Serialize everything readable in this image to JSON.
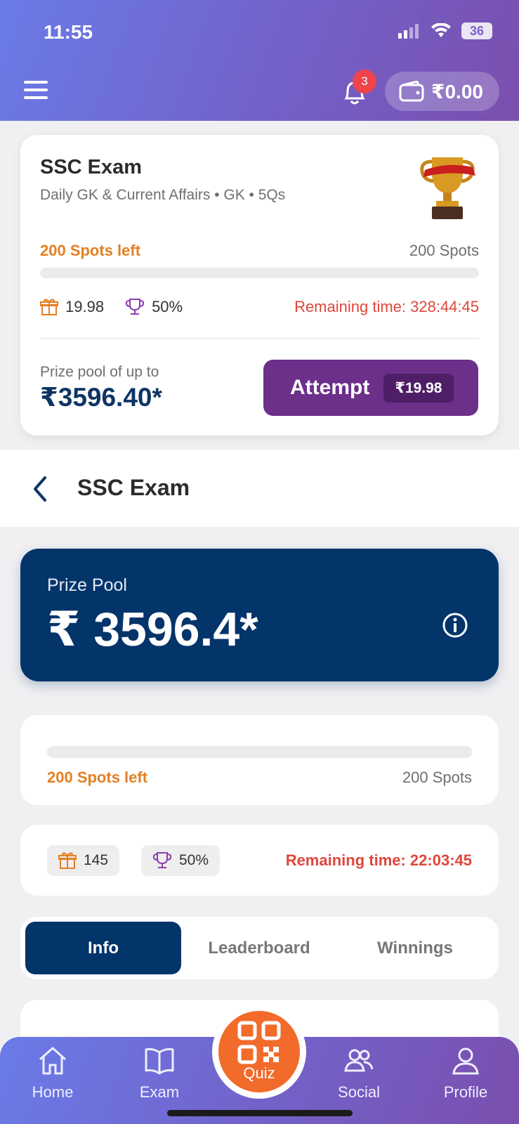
{
  "status_bar": {
    "time": "11:55",
    "battery": "36"
  },
  "header": {
    "notification_count": "3",
    "wallet_balance": "₹0.00"
  },
  "contest_card": {
    "title": "SSC Exam",
    "subtitle": "Daily GK & Current Affairs • GK • 5Qs",
    "spots_left": "200 Spots left",
    "spots_total": "200 Spots",
    "spots_filled_fraction": 0,
    "entry_reward": "19.98",
    "win_percent": "50%",
    "remaining_time": "Remaining time: 328:44:45",
    "prize_pool_label": "Prize pool of up to",
    "prize_pool_value": "₹3596.40*",
    "attempt_label": "Attempt",
    "attempt_fee": "₹19.98"
  },
  "nav": {
    "title": "SSC Exam"
  },
  "prize_pool": {
    "label": "Prize Pool",
    "value": "₹ 3596.4*"
  },
  "spots": {
    "left": "200 Spots left",
    "total": "200 Spots",
    "filled_fraction": 0
  },
  "stats": {
    "gift_value": "145",
    "win_percent": "50%",
    "remaining_time": "Remaining time: 22:03:45"
  },
  "tabs": [
    {
      "label": "Info",
      "active": true
    },
    {
      "label": "Leaderboard",
      "active": false
    },
    {
      "label": "Winnings",
      "active": false
    }
  ],
  "bottom_nav": {
    "home": "Home",
    "exam": "Exam",
    "quiz": "Quiz",
    "social": "Social",
    "profile": "Profile"
  },
  "colors": {
    "accent_orange": "#e47f23",
    "navy": "#03346a",
    "attempt_purple": "#6c2f8a",
    "alert_red": "#e0463c"
  }
}
